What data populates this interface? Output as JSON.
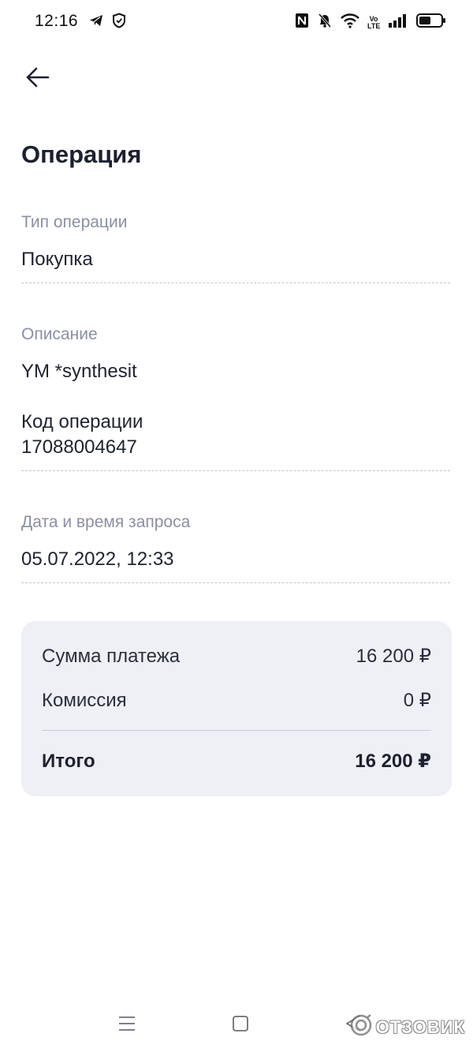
{
  "status_bar": {
    "time": "12:16",
    "left_icons": [
      "telegram-icon",
      "shield-icon"
    ],
    "right_icons": [
      "nfc-icon",
      "bell-off-icon",
      "wifi-icon",
      "volte-icon",
      "signal-icon",
      "battery-icon"
    ],
    "volte_text": "Vo LTE"
  },
  "header": {
    "back_icon": "arrow-left-icon",
    "title": "Операция"
  },
  "details": {
    "operation_type": {
      "label": "Тип операции",
      "value": "Покупка"
    },
    "description": {
      "label": "Описание",
      "value": "YM *synthesit"
    },
    "operation_code": {
      "label": "Код операции",
      "value": "17088004647"
    },
    "request_datetime": {
      "label": "Дата и время запроса",
      "value": "05.07.2022, 12:33"
    }
  },
  "summary": {
    "payment": {
      "label": "Сумма платежа",
      "value": "16 200 ₽"
    },
    "fee": {
      "label": "Комиссия",
      "value": "0 ₽"
    },
    "total": {
      "label": "Итого",
      "value": "16 200 ₽"
    }
  },
  "nav_bar": {
    "buttons": [
      "menu-icon",
      "home-icon",
      "back-icon"
    ]
  },
  "watermark": {
    "text": "ОТЗОВИК"
  },
  "colors": {
    "label": "#8a8fa3",
    "text": "#1f2330",
    "card_bg": "#eef0f5",
    "divider": "#c5c8d2"
  }
}
